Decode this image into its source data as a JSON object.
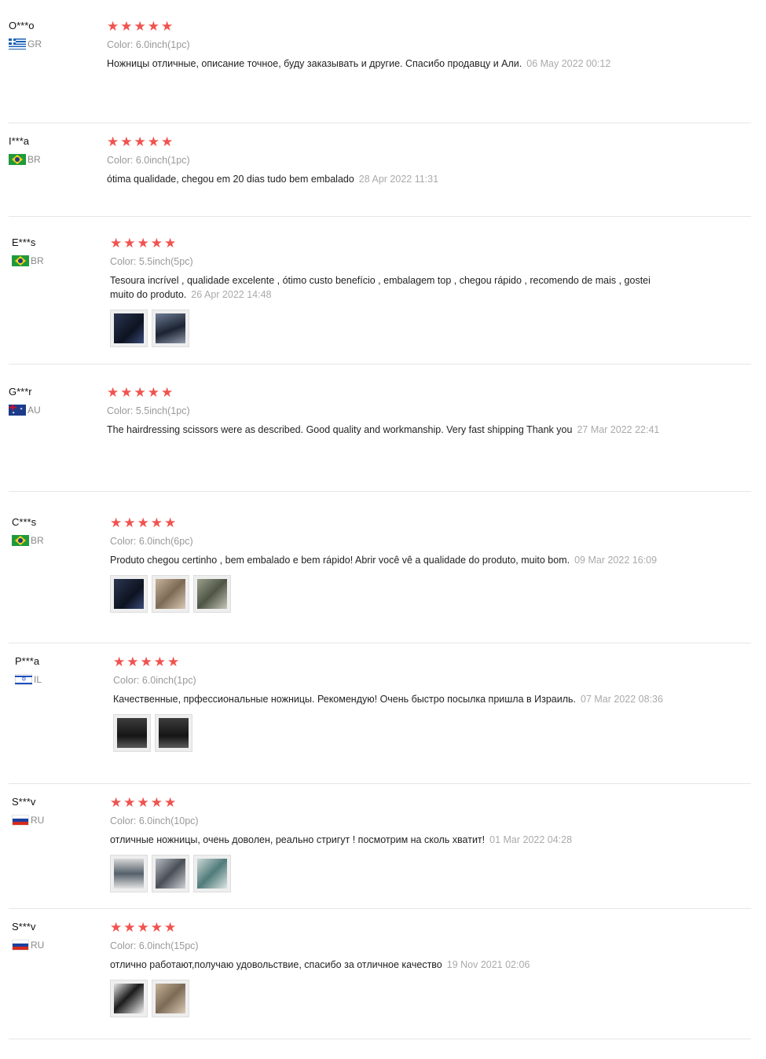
{
  "reviews": [
    {
      "user": "O***o",
      "country": "GR",
      "flag": "gr",
      "sku_label": "Color:",
      "sku_value": "6.0inch(1pc)",
      "text": "Ножницы отличные, описание точное, буду заказывать и другие. Спасибо продавцу и Али.",
      "date": "06 May 2022 00:12",
      "photos": []
    },
    {
      "user": "I***a",
      "country": "BR",
      "flag": "br",
      "sku_label": "Color:",
      "sku_value": "6.0inch(1pc)",
      "text": "ótima qualidade, chegou em 20 dias tudo bem embalado",
      "date": "28 Apr 2022 11:31",
      "photos": []
    },
    {
      "user": "E***s",
      "country": "BR",
      "flag": "br",
      "sku_label": "Color:",
      "sku_value": "5.5inch(5pc)",
      "text": "Tesoura incrível , qualidade excelente , ótimo custo benefício , embalagem top , chegou rápido , recomendo de mais , gostei muito do produto.",
      "date": "26 Apr 2022 14:48",
      "photos": [
        "dark-blue",
        "dark-gray"
      ]
    },
    {
      "user": "G***r",
      "country": "AU",
      "flag": "au",
      "sku_label": "Color:",
      "sku_value": "5.5inch(1pc)",
      "text": "The hairdressing scissors were as described. Good quality and workmanship. Very fast shipping Thank you",
      "date": "27 Mar 2022 22:41",
      "photos": []
    },
    {
      "user": "C***s",
      "country": "BR",
      "flag": "br",
      "sku_label": "Color:",
      "sku_value": "6.0inch(6pc)",
      "text": "Produto chegou certinho , bem embalado e bem rápido! Abrir você vê a qualidade do produto, muito bom.",
      "date": "09 Mar 2022 16:09",
      "photos": [
        "dark-blue",
        "tan",
        "olive"
      ]
    },
    {
      "user": "P***a",
      "country": "IL",
      "flag": "il",
      "sku_label": "Color:",
      "sku_value": "6.0inch(1pc)",
      "text": "Качественные, прфессиональные ножницы. Рекомендую! Очень быстро посылка пришла в Израиль.",
      "date": "07 Mar 2022 08:36",
      "photos": [
        "dark",
        "dark"
      ]
    },
    {
      "user": "S***v",
      "country": "RU",
      "flag": "ru",
      "sku_label": "Color:",
      "sku_value": "6.0inch(10pc)",
      "text": "отличные ножницы, очень доволен, реально стригут ! посмотрим на сколь хватит!",
      "date": "01 Mar 2022 04:28",
      "photos": [
        "light",
        "gray",
        "teal"
      ]
    },
    {
      "user": "S***v",
      "country": "RU",
      "flag": "ru",
      "sku_label": "Color:",
      "sku_value": "6.0inch(15pc)",
      "text": "отлично работают,получаю удовольствие, спасибо за отличное качество",
      "date": "19 Nov 2021 02:06",
      "photos": [
        "dark-white",
        "tan"
      ]
    }
  ],
  "rating_stars": "★★★★★"
}
